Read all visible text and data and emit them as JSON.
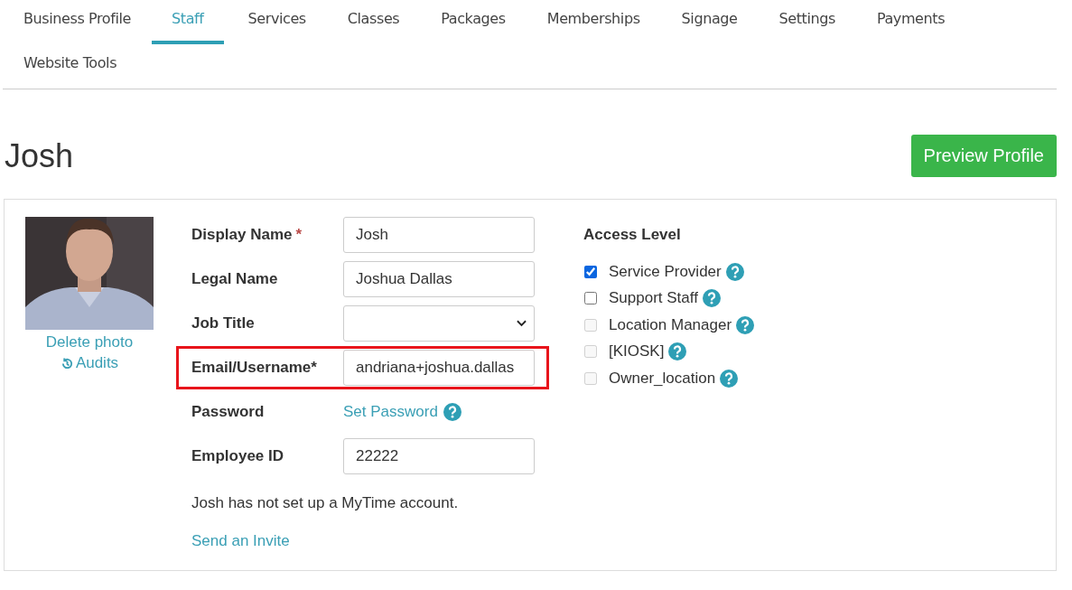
{
  "tabs": [
    {
      "label": "Business Profile",
      "selected": false
    },
    {
      "label": "Staff",
      "selected": true
    },
    {
      "label": "Services",
      "selected": false
    },
    {
      "label": "Classes",
      "selected": false
    },
    {
      "label": "Packages",
      "selected": false
    },
    {
      "label": "Memberships",
      "selected": false
    },
    {
      "label": "Signage",
      "selected": false
    },
    {
      "label": "Settings",
      "selected": false
    },
    {
      "label": "Payments",
      "selected": false
    },
    {
      "label": "Website Tools",
      "selected": false
    }
  ],
  "page_title": "Josh",
  "preview_button": "Preview Profile",
  "photo": {
    "kind": "picture",
    "delete_link": "Delete photo",
    "audits_link": "Audits"
  },
  "fields": [
    {
      "kind": "text",
      "label": "Display Name",
      "required_mark": "*",
      "value": "Josh",
      "highlighted": false
    },
    {
      "kind": "text",
      "label": "Legal Name",
      "value": "Joshua Dallas",
      "highlighted": false
    },
    {
      "kind": "select",
      "label": "Job Title",
      "highlighted": false
    },
    {
      "kind": "text",
      "label": "Email/Username*",
      "value": "andriana+joshua.dallas",
      "highlighted": true
    },
    {
      "kind": "link",
      "label": "Password",
      "link": "Set Password",
      "highlighted": false
    },
    {
      "kind": "text",
      "label": "Employee ID",
      "value": "22222",
      "highlighted": false
    }
  ],
  "account_note": "Josh has not set up a MyTime account.",
  "invite_link": "Send an Invite",
  "access_level": {
    "title": "Access Level",
    "options": [
      {
        "label": "Service Provider",
        "checked": true,
        "disabled": false
      },
      {
        "label": "Support Staff",
        "checked": false,
        "disabled": false
      },
      {
        "label": "Location Manager",
        "checked": false,
        "disabled": true
      },
      {
        "label": "[KIOSK]",
        "checked": false,
        "disabled": true
      },
      {
        "label": "Owner_location",
        "checked": false,
        "disabled": true
      }
    ]
  }
}
